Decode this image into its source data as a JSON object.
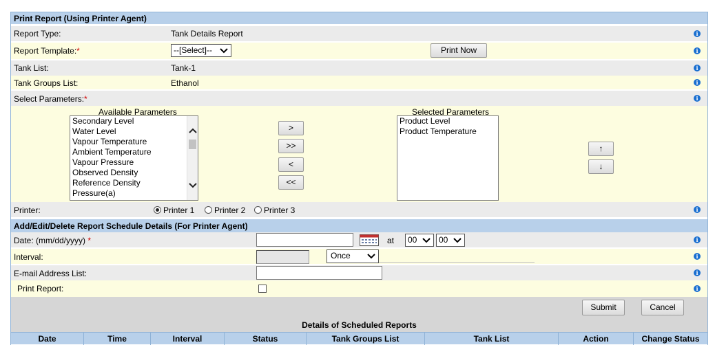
{
  "print_section": {
    "title": "Print Report (Using Printer Agent)",
    "report_type_label": "Report Type:",
    "report_type_value": "Tank Details Report",
    "report_template_label": "Report Template:",
    "required_mark": "*",
    "report_template_value": "--[Select]--",
    "print_now_label": "Print Now",
    "tank_list_label": "Tank List:",
    "tank_list_value": "Tank-1",
    "tank_groups_label": "Tank Groups List:",
    "tank_groups_value": "Ethanol",
    "select_params_label": "Select Parameters:",
    "available_title": "Available Parameters",
    "available_params": [
      "Secondary Level",
      "Water Level",
      "Vapour Temperature",
      "Ambient Temperature",
      "Vapour Pressure",
      "Observed Density",
      "Reference Density",
      "Pressure(a)"
    ],
    "selected_title": "Selected Parameters",
    "selected_params": [
      "Product Level",
      "Product Temperature"
    ],
    "move_buttons": [
      ">",
      ">>",
      "<",
      "<<"
    ],
    "order_buttons": [
      "↑",
      "↓"
    ],
    "printer_label": "Printer:",
    "printers": [
      "Printer 1",
      "Printer 2",
      "Printer 3"
    ],
    "selected_printer": "Printer 1"
  },
  "schedule_section": {
    "title": "Add/Edit/Delete Report Schedule Details (For Printer Agent)",
    "date_label": "Date: (mm/dd/yyyy)",
    "date_value": "",
    "at_label": "at",
    "hour_value": "00",
    "minute_value": "00",
    "interval_label": "Interval:",
    "interval_value": "Once",
    "email_label": "E-mail Address List:",
    "email_value": "",
    "print_report_label": "Print Report:",
    "print_report_checked": false,
    "submit_label": "Submit",
    "cancel_label": "Cancel"
  },
  "scheduled_table": {
    "title": "Details of Scheduled Reports",
    "columns": [
      "Date",
      "Time",
      "Interval",
      "Status",
      "Tank Groups List",
      "Tank List",
      "Action",
      "Change Status"
    ]
  },
  "icons": {
    "info": "info-icon",
    "calendar": "calendar-icon"
  },
  "colors": {
    "header_bg": "#b8d0ea",
    "required": "#d00000",
    "table_header_bg": "#b8d0ea",
    "info_icon": "#1a6fd0"
  }
}
